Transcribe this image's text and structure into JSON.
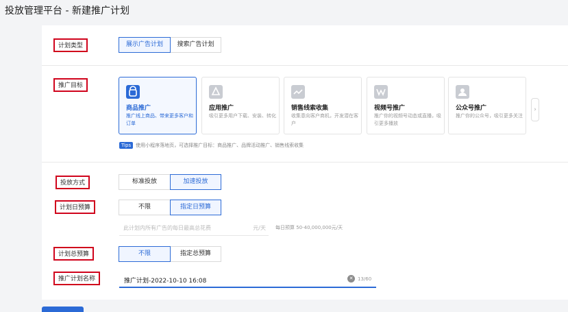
{
  "page": {
    "title": "投放管理平台 - 新建推广计划"
  },
  "plan_type": {
    "label": "计划类型",
    "options": [
      "展示广告计划",
      "搜索广告计划"
    ],
    "selected": "展示广告计划"
  },
  "goal": {
    "label": "推广目标",
    "cards": [
      {
        "title": "商品推广",
        "desc": "推广线上商品、带来更多客户和订单",
        "icon": "shopping-bag-icon",
        "active": true
      },
      {
        "title": "应用推广",
        "desc": "吸引更多用户下载、安装、转化",
        "icon": "app-icon",
        "active": false
      },
      {
        "title": "销售线索收集",
        "desc": "收集意向客户商机，开发潜在客户",
        "icon": "leads-icon",
        "active": false
      },
      {
        "title": "视频号推广",
        "desc": "推广你的视频号动态或直播，吸引更多播放",
        "icon": "video-channel-icon",
        "active": false
      },
      {
        "title": "公众号推广",
        "desc": "推广你的公众号，吸引更多关注",
        "icon": "official-account-icon",
        "active": false
      }
    ],
    "next_icon": "chevron-right-icon",
    "tips_badge": "Tips",
    "tips_text": "使用小程序落地页，可选择推广目标：商品推广、品牌活动推广、销售线索收集"
  },
  "delivery": {
    "label": "投放方式",
    "options": [
      "标准投放",
      "加速投放"
    ],
    "selected": "加速投放"
  },
  "daily_budget": {
    "label": "计划日预算",
    "options": [
      "不限",
      "指定日预算"
    ],
    "selected": "指定日预算",
    "placeholder": "此计划内所有广告的每日最高总花费",
    "unit": "元/天",
    "hint": "每日预算 50-40,000,000元/天"
  },
  "total_budget": {
    "label": "计划总预算",
    "options": [
      "不限",
      "指定总预算"
    ],
    "selected": "不限"
  },
  "plan_name": {
    "label": "推广计划名称",
    "value": "推广计划-2022-10-10 16:08",
    "count": "13/60",
    "clear_icon": "clear-icon"
  },
  "colors": {
    "accent": "#2b6ad6",
    "highlight_box": "#d0021b"
  }
}
